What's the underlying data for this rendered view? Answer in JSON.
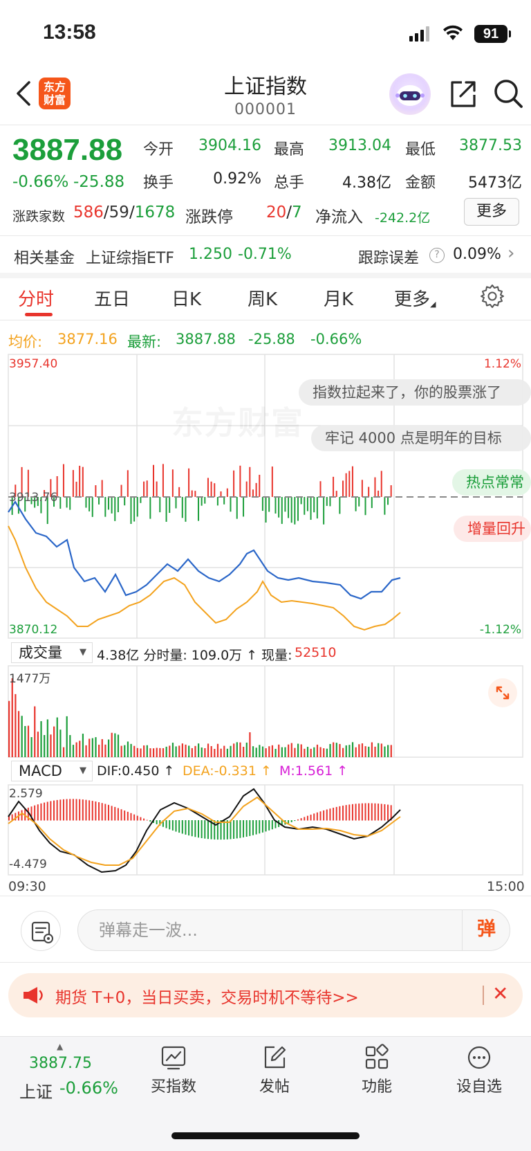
{
  "status": {
    "time": "13:58",
    "battery": "91"
  },
  "header": {
    "logo_line1": "东方",
    "logo_line2": "财富",
    "title": "上证指数",
    "code": "000001"
  },
  "quote": {
    "price": "3887.88",
    "change_pct": "-0.66%",
    "change_abs": "-25.88",
    "open_label": "今开",
    "open": "3904.16",
    "high_label": "最高",
    "high": "3913.04",
    "low_label": "最低",
    "low": "3877.53",
    "turnover_label": "换手",
    "turnover": "0.92%",
    "volume_label": "总手",
    "volume": "4.38亿",
    "amount_label": "金额",
    "amount": "5473亿",
    "breadth_label": "涨跌家数",
    "breadth_up": "586",
    "breadth_flat": "59",
    "breadth_down": "1678",
    "limit_label": "涨跌停",
    "limit_up": "20",
    "limit_down": "7",
    "netflow_label": "净流入",
    "netflow": "-242.2亿",
    "more_label": "更多"
  },
  "fund": {
    "label": "相关基金",
    "name": "上证综指ETF",
    "price": "1.250",
    "change": "-0.71%",
    "track_label": "跟踪误差",
    "track_help": "?",
    "track_value": "0.09%"
  },
  "tabs": [
    "分时",
    "五日",
    "日K",
    "周K",
    "月K",
    "更多"
  ],
  "info": {
    "avg_label": "均价:",
    "avg": "3877.16",
    "last_label": "最新:",
    "last": "3887.88",
    "last_chg": "-25.88",
    "last_pct": "-0.66%"
  },
  "chart": {
    "y_top": "3957.40",
    "y_mid": "3913.76",
    "y_bottom": "3870.12",
    "pct_top": "1.12%",
    "pct_bottom": "-1.12%",
    "watermark": "东方财富",
    "bubbles": [
      "指数拉起来了，你的股票涨了",
      "牢记 4000 点是明年的目标",
      "热点常常",
      "增量回升"
    ]
  },
  "volume": {
    "selector": "成交量",
    "info": "4.38亿 分时量: 109.0万 ↑ 现量: ",
    "current": "52510",
    "max_label": "1477万"
  },
  "macd": {
    "selector": "MACD",
    "dif": "DIF:0.450 ↑",
    "dea": "DEA:-0.331 ↑",
    "m": "M:1.561 ↑",
    "hi": "2.579",
    "lo": "-4.479"
  },
  "time_axis": {
    "start": "09:30",
    "end": "15:00"
  },
  "danmu": {
    "placeholder": "弹幕走一波...",
    "send": "弹"
  },
  "promo": {
    "text": "期货 T+0，当日买卖，交易时机不等待>>",
    "close": "✕"
  },
  "bottom": {
    "price": "3887.75",
    "name": "上证",
    "pct": "-0.66%",
    "items": [
      "买指数",
      "发帖",
      "功能",
      "设自选"
    ]
  },
  "colors": {
    "up": "#e8342c",
    "down": "#1b9e3a",
    "avg": "#f3a21d",
    "price_line": "#2a66c8",
    "brand": "#f5561a"
  }
}
